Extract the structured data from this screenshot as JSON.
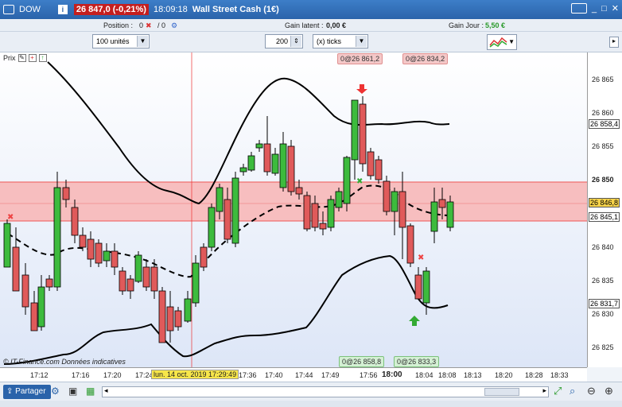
{
  "titlebar": {
    "symbol": "DOW",
    "price": "26 847,0 (-0,21%)",
    "time": "18:09:18",
    "name": "Wall Street Cash (1€)"
  },
  "infobar": {
    "position_label": "Position :",
    "position_value": "0",
    "position_sep": "/ 0",
    "latent_label": "Gain latent :",
    "latent_value": "0,00 €",
    "day_label": "Gain Jour :",
    "day_value": "5,50 €"
  },
  "toolbar": {
    "units": "100 unités",
    "ticks_value": "200",
    "ticks_unit": "(x) ticks"
  },
  "chart_header": {
    "label": "Prix"
  },
  "tags": {
    "top_left": "0@26 861,2",
    "top_right": "0@26 834,2",
    "bottom_left": "0@26 858,8",
    "bottom_right": "0@26 833,3",
    "crosshair_time": "lun. 14 oct. 2019 17:29:49",
    "source": "© IT-Finance.com Données indicatives"
  },
  "yaxis": {
    "labels": [
      "26 865",
      "26 860",
      "26 855",
      "26 850",
      "26 840",
      "26 835",
      "26 830",
      "26 825"
    ],
    "boxes": [
      "26 858,4",
      "26 846,8",
      "26 845,1",
      "26 831,7"
    ]
  },
  "xaxis": {
    "labels": [
      "17:12",
      "17:16",
      "17:20",
      "17:24",
      "17:36",
      "17:40",
      "17:44",
      "17:49",
      "17:56",
      "18:00",
      "18:04",
      "18:08",
      "18:13",
      "18:20",
      "18:28",
      "18:33"
    ]
  },
  "bottombar": {
    "share": "Partager"
  },
  "colors": {
    "up": "#3dbb3d",
    "down": "#e05a5a",
    "band": "#f7b8b8",
    "line": "#000000"
  }
}
